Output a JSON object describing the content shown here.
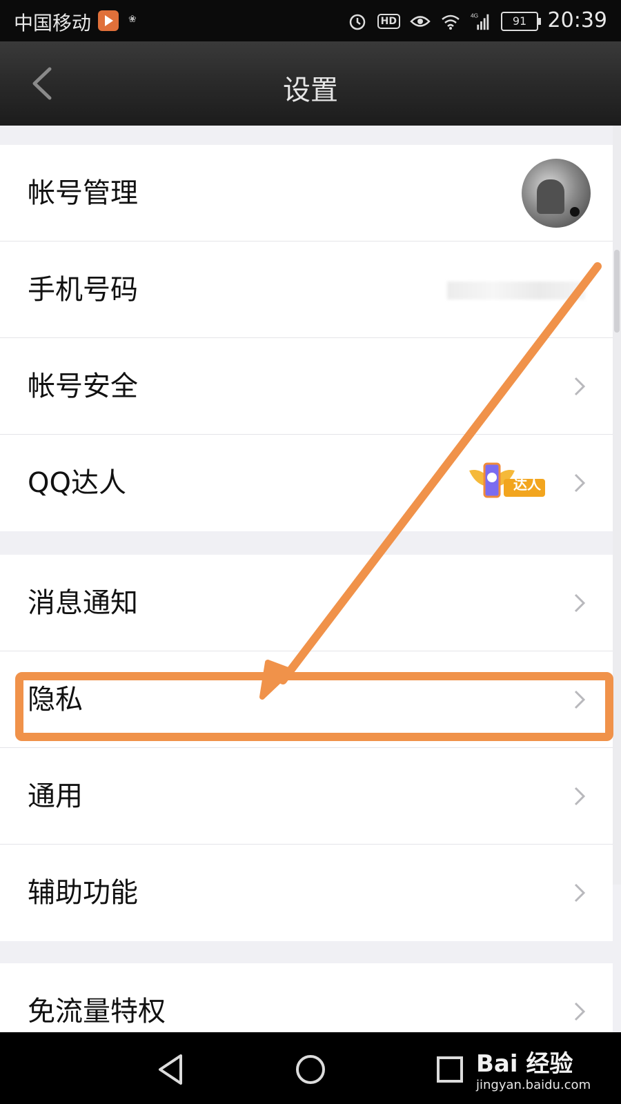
{
  "status_bar": {
    "carrier": "中国移动",
    "hd": "HD",
    "network": "4G",
    "battery": "91",
    "time": "20:39"
  },
  "header": {
    "title": "设置",
    "back_icon": "chevron-left-icon"
  },
  "groups": [
    {
      "items": [
        {
          "label": "帐号管理",
          "accessory": "avatar"
        },
        {
          "label": "手机号码",
          "accessory": "blurred-number"
        },
        {
          "label": "帐号安全",
          "accessory": "chevron"
        },
        {
          "label": "QQ达人",
          "accessory": "badge",
          "badge_text": "达人"
        }
      ]
    },
    {
      "items": [
        {
          "label": "消息通知",
          "accessory": "chevron"
        },
        {
          "label": "隐私",
          "accessory": "chevron",
          "highlighted": true
        },
        {
          "label": "通用",
          "accessory": "chevron"
        },
        {
          "label": "辅助功能",
          "accessory": "chevron"
        }
      ]
    },
    {
      "items": [
        {
          "label": "免流量特权",
          "accessory": "chevron"
        }
      ]
    }
  ],
  "annotation": {
    "color": "#f0924a"
  },
  "watermark": {
    "logo": "Bai 经验",
    "url": "jingyan.baidu.com"
  },
  "colors": {
    "accent_orange": "#f0924a",
    "header_bg": "#2b2b2b",
    "background": "#f0f0f4"
  }
}
